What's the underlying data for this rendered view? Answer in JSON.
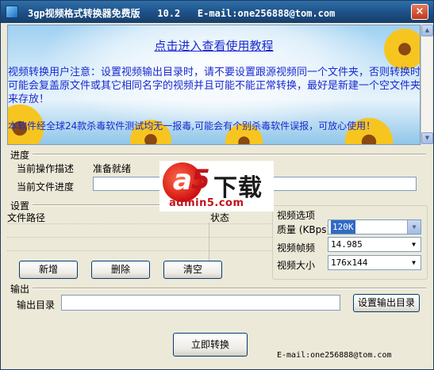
{
  "window": {
    "title": "3gp视频格式转换器免费版   10.2   E-mail:one256888@tom.com",
    "close_label": "×"
  },
  "banner": {
    "link_text": "点击进入查看使用教程",
    "notice": "视频转换用户注意：设置视频输出目录时，请不要设置跟源视频同一个文件夹，否则转换时可能会复盖原文件或其它相同名字的视频并且可能不能正常转换，最好是新建一个空文件夹来存放！",
    "antivirus": "本软件经全球24款杀毒软件测试均无一报毒,可能会有个别杀毒软件误报，可放心使用！",
    "colors": {
      "text": "#1a2acf"
    }
  },
  "progress_section": {
    "title": "进度",
    "current_op_label": "当前操作描述",
    "current_op_value": "准备就绪",
    "current_file_label": "当前文件进度",
    "progress_fraction": 0.0
  },
  "settings": {
    "title": "设置",
    "columns": [
      "文件路径",
      "状态"
    ],
    "rows": [],
    "buttons": {
      "add": "新增",
      "delete": "删除",
      "clear": "清空"
    }
  },
  "video_options": {
    "title": "视频选项",
    "quality_label": "质量 (KBps)",
    "quality_value": "120K",
    "framerate_label": "视频帧频",
    "framerate_value": "14.985",
    "size_label": "视频大小",
    "size_value": "176x144"
  },
  "output": {
    "title": "输出",
    "dir_label": "输出目录",
    "dir_value": "",
    "set_dir_button": "设置输出目录"
  },
  "convert_button": "立即转换",
  "footer_email": "E-mail:one256888@tom.com",
  "watermark": {
    "a": "a",
    "five": "5",
    "cn": "下载",
    "url": "admin5.com"
  }
}
